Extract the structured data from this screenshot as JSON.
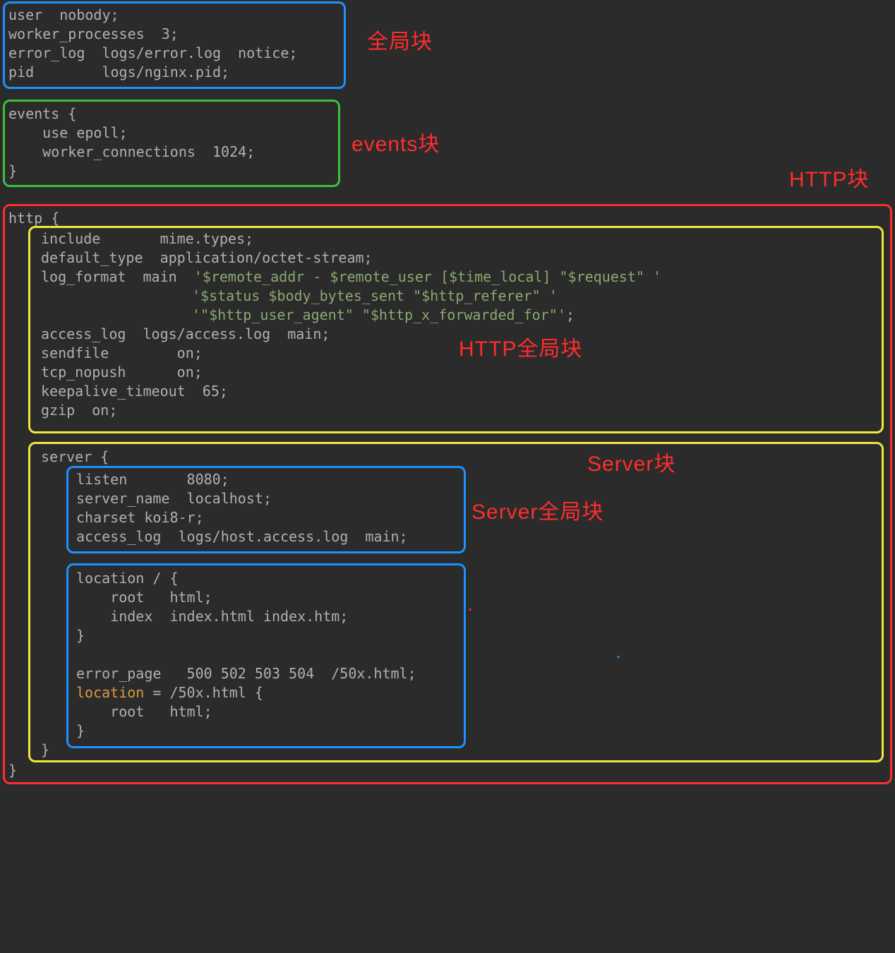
{
  "labels": {
    "global": "全局块",
    "events": "events块",
    "http": "HTTP块",
    "http_global": "HTTP全局块",
    "server": "Server块",
    "server_global": "Server全局块"
  },
  "code": {
    "l1": "user  nobody;",
    "l2": "worker_processes  3;",
    "l3": "error_log  logs/error.log  notice;",
    "l4": "pid        logs/nginx.pid;",
    "l5": "events {",
    "l6": "    use epoll;",
    "l7": "    worker_connections  1024;",
    "l8": "}",
    "l9": "http {",
    "l10": "include       mime.types;",
    "l11": "default_type  application/octet-stream;",
    "l12a": "log_format  main  ",
    "l12b": "'$remote_addr - $remote_user [$time_local] \"$request\" '",
    "l13": "'$status $body_bytes_sent \"$http_referer\" '",
    "l14a": "'\"$http_user_agent\" \"$http_x_forwarded_for\"'",
    "l14b": ";",
    "l15": "access_log  logs/access.log  main;",
    "l16": "sendfile        on;",
    "l17": "tcp_nopush      on;",
    "l18": "keepalive_timeout  65;",
    "l19": "gzip  on;",
    "l20": "server {",
    "l21": "listen       8080;",
    "l22": "server_name  localhost;",
    "l23": "charset koi8-r;",
    "l24": "access_log  logs/host.access.log  main;",
    "l25": "location / {",
    "l26": "    root   html;",
    "l27": "    index  index.html index.htm;",
    "l28": "}",
    "l29": "error_page   500 502 503 504  /50x.html;",
    "l30a": "location",
    "l30b": " = /50x.html {",
    "l31": "    root   html;",
    "l32": "}",
    "l33": "}",
    "l34": "}"
  }
}
